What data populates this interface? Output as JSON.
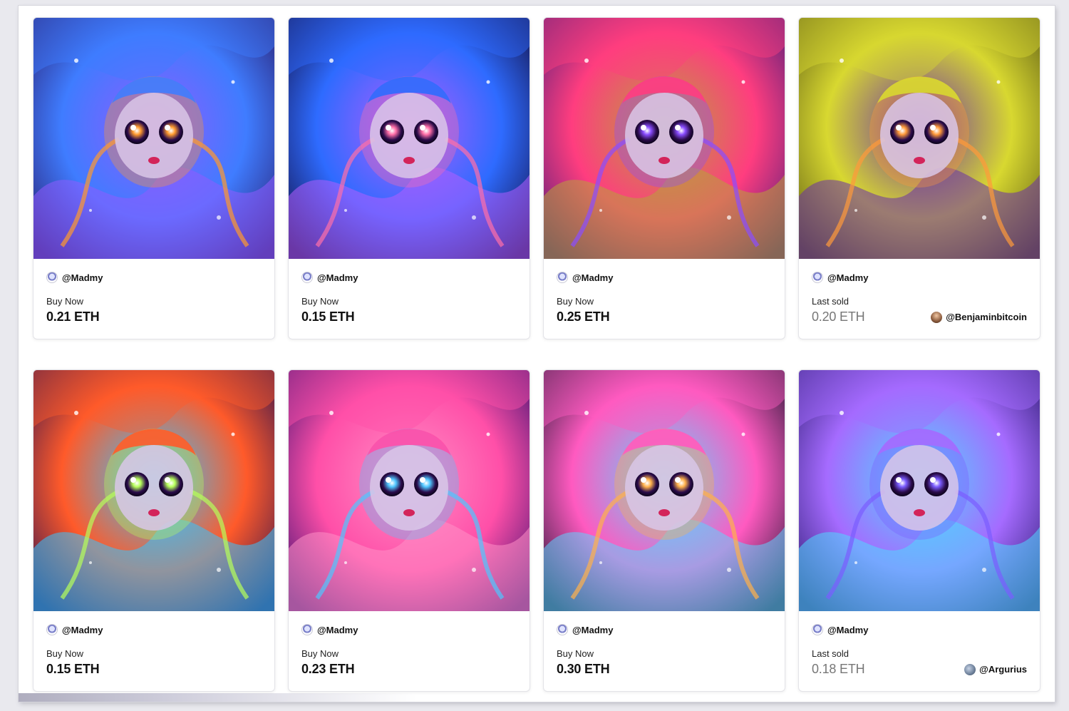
{
  "cards": [
    {
      "creator": "@Madmy",
      "status": "Buy Now",
      "price": "0.21 ETH",
      "sold": false,
      "owner": "",
      "palette": [
        "#2a1b6b",
        "#3f7cff",
        "#8f5bff",
        "#ff9a2e"
      ]
    },
    {
      "creator": "@Madmy",
      "status": "Buy Now",
      "price": "0.15 ETH",
      "sold": false,
      "owner": "",
      "palette": [
        "#120a3a",
        "#2e6bff",
        "#b35cff",
        "#ff6fa8"
      ]
    },
    {
      "creator": "@Madmy",
      "status": "Buy Now",
      "price": "0.25 ETH",
      "sold": false,
      "owner": "",
      "palette": [
        "#4b1d7a",
        "#ff3d7f",
        "#b8a23a",
        "#8a4dff"
      ]
    },
    {
      "creator": "@Madmy",
      "status": "Last sold",
      "price": "0.20 ETH",
      "sold": true,
      "owner": "@Benjaminbitcoin",
      "palette": [
        "#5c5a14",
        "#d8d830",
        "#6a2fa8",
        "#ff9a3a"
      ]
    },
    {
      "creator": "@Madmy",
      "status": "Buy Now",
      "price": "0.15 ETH",
      "sold": false,
      "owner": "",
      "palette": [
        "#2b1050",
        "#ff5a2a",
        "#35c4ff",
        "#b6ff5a"
      ]
    },
    {
      "creator": "@Madmy",
      "status": "Buy Now",
      "price": "0.23 ETH",
      "sold": false,
      "owner": "",
      "palette": [
        "#3a1070",
        "#ff4fa8",
        "#ff8fc6",
        "#4fc6ff"
      ]
    },
    {
      "creator": "@Madmy",
      "status": "Buy Now",
      "price": "0.30 ETH",
      "sold": false,
      "owner": "",
      "palette": [
        "#1b1530",
        "#ff5ac0",
        "#5fd2ff",
        "#ffb14a"
      ]
    },
    {
      "creator": "@Madmy",
      "status": "Last sold",
      "price": "0.18 ETH",
      "sold": true,
      "owner": "@Argurius",
      "palette": [
        "#2a1a6e",
        "#a56bff",
        "#4fd8ff",
        "#7a5cff"
      ]
    }
  ]
}
